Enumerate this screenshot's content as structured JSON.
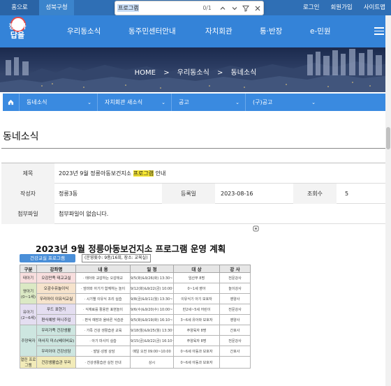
{
  "topbar": {
    "home_label": "홈으로",
    "gu_label": "성북구청",
    "login": "로그인",
    "join": "회원가입",
    "sitemap": "사이트맵"
  },
  "findbar": {
    "query": "프로그램",
    "count": "0/1",
    "icons": [
      "chevron-up-icon",
      "chevron-down-icon",
      "filter-icon",
      "close-icon"
    ]
  },
  "logo": {
    "line1": "정릉아",
    "line2": "답을"
  },
  "nav": {
    "items": [
      "우리동소식",
      "동주민센터안내",
      "자치회관",
      "통·반장",
      "e-민원"
    ]
  },
  "breadcrumb": {
    "home": "HOME",
    "sep": ">",
    "level1": "우리동소식",
    "level2": "동네소식"
  },
  "subnav": {
    "items": [
      "동네소식",
      "자치회관 새소식",
      "공고",
      "(구)공고"
    ]
  },
  "page": {
    "title": "동네소식"
  },
  "post": {
    "subject_label": "제목",
    "subject_prefix": "2023년 9월 정릉아동보건지소 ",
    "subject_highlight": "프로그램",
    "subject_suffix": " 안내",
    "author_label": "작성자",
    "author": "정릉3동",
    "date_label": "등록일",
    "date": "2023-08-16",
    "views_label": "조회수",
    "views": "5",
    "attach_label": "첨부파일",
    "attach_value": "첨부파일이 없습니다."
  },
  "poster": {
    "title": "2023년 9월 정릉아동보건지소 프로그램 운영 계획",
    "tag": "건강교실 프로그램",
    "note": "(운영횟수: 9종/16회, 장소: 교육실)",
    "headers": [
      "구분",
      "강좌명",
      "내 용",
      "일 정",
      "대 상",
      "강 사"
    ],
    "rows": [
      {
        "group": "태아기",
        "prog": "오감만족 태교교실",
        "content": "· 태아와 교감하는 오감태교",
        "schedule": "9/5(화)&9/26(화) 13:30~15:30",
        "target": "임산부 8명",
        "teacher": "전문강사"
      },
      {
        "group": "영아기 (0~1세)",
        "prog": "오감수유놀이식",
        "content": "· 엄마와 아기가 함께하는 놀이",
        "schedule": "9/12(화)&9/22(금) 10:00~12:00",
        "target": "0~1세 영아",
        "teacher": "놀이강사"
      },
      {
        "group": "",
        "prog": "우리아이 이유식교실",
        "content": "· 시기별 이유식 조리 실습",
        "schedule": "9/8(금)&9/11(월) 13:30~14:30",
        "target": "이유식기 아기 보호자",
        "teacher": "영양사"
      },
      {
        "group": "유아기 (2~6세)",
        "prog": "푸드 표현기",
        "content": "· 식재료를 활용한 표현놀이",
        "schedule": "9/6(수)&9/20(수) 10:00~10:40",
        "target": "만2세~5세 어린이",
        "teacher": "전문강사"
      },
      {
        "group": "",
        "prog": "편식예방 머니주입",
        "content": "· 편식 예방과 올바른 식습관",
        "schedule": "9/5(화)&9/19(화) 16:10~17:10",
        "target": "3~6세 유아와 보호자",
        "teacher": "영양사"
      },
      {
        "group": "",
        "prog": "우리가족 건강생활",
        "content": "· 가족 건강 생활습관 교육",
        "schedule": "9/18(월)&9/25(월) 13:30~14:30",
        "target": "주양육자 8명",
        "teacher": "간호사"
      },
      {
        "group": "주양육자",
        "prog": "마사지 미스(베이비요)",
        "content": "· 아기 마사지 실습",
        "schedule": "9/15(금)&9/22(금) 16:10~17:10",
        "target": "주양육자 8명",
        "teacher": "전문강사"
      },
      {
        "group": "",
        "prog": "우리아이 건강상담",
        "content": "· 발달·성장 상담",
        "schedule": "매일 오전 09:00~10:00",
        "target": "0~6세 아동과 보호자",
        "teacher": "간호사"
      },
      {
        "group": "열린 프로그램",
        "prog": "건강생활습관 우리",
        "content": "· 건강생활습관 실천 안내",
        "schedule": "상시",
        "target": "0~6세 아동과 보호자",
        "teacher": ""
      }
    ]
  },
  "colors": {
    "topbar": "#2f6fb5",
    "header": "#3483d8",
    "subnav": "#3a8ae0",
    "highlight": "#f6e631"
  }
}
